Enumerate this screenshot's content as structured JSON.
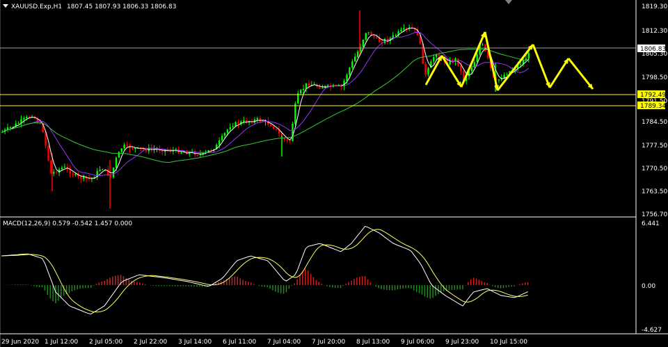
{
  "header": {
    "symbol_icon": "triangle-down-icon",
    "symbol": "XAUUSD.Exp,H1",
    "ohlc": "1807.45 1807.93 1806.33 1806.83"
  },
  "macd": {
    "label": "MACD(12,26,9) 0.579 -0.542 1.457 0.000",
    "scale": [
      "6.441",
      "0.00",
      "-4.627"
    ]
  },
  "price_scale": [
    "1819.30",
    "1812.30",
    "1805.30",
    "1798.50",
    "1791.50",
    "1784.50",
    "1777.50",
    "1770.50",
    "1763.50",
    "1756.70"
  ],
  "level_labels": {
    "current": "1806.83",
    "upper": "1792.49",
    "lower": "1789.34"
  },
  "time_axis": [
    "29 Jun 2020",
    "1 Jul 12:00",
    "2 Jul 05:00",
    "2 Jul 22:00",
    "3 Jul 14:00",
    "6 Jul 11:00",
    "7 Jul 04:00",
    "7 Jul 20:00",
    "8 Jul 13:00",
    "9 Jul 06:00",
    "9 Jul 23:00",
    "10 Jul 15:00"
  ],
  "colors": {
    "background": "#000000",
    "bull": "#00ff00",
    "bear": "#ff0000",
    "level_line": "#ffff00",
    "current_line": "#c0c0c0",
    "ma_fast": "#ffffff",
    "ma_mid": "#9933ff",
    "ma_slow": "#33cc33",
    "projection": "#ffff00",
    "macd_hist_pos": "#cc2222",
    "macd_hist_neg": "#228822"
  }
}
